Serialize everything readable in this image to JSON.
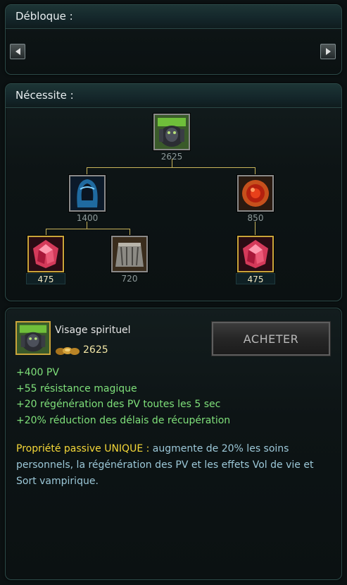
{
  "unlock": {
    "title": "Débloque :"
  },
  "requires": {
    "title": "Nécessite :",
    "tree": {
      "root": {
        "name": "Visage spirituel",
        "icon": "armor-helm-icon",
        "price": "2625"
      },
      "children": [
        {
          "icon": "hooded-cloak-icon",
          "price": "1400",
          "children": [
            {
              "icon": "ruby-crystal-icon",
              "price": "475",
              "owned": true
            },
            {
              "icon": "cloth-cloak-icon",
              "price": "720",
              "owned": false
            }
          ]
        },
        {
          "icon": "red-orb-icon",
          "price": "850",
          "children": [
            {
              "icon": "ruby-crystal-icon",
              "price": "475",
              "owned": true
            }
          ]
        }
      ]
    }
  },
  "info": {
    "name": "Visage spirituel",
    "icon": "armor-helm-icon",
    "cost": "2625",
    "buy_label": "ACHETER",
    "stats": [
      "+400 PV",
      "+55 résistance magique",
      "+20 régénération des PV toutes les 5 sec",
      "+20% réduction des délais de récupération"
    ],
    "passive_label": "Propriété passive UNIQUE :",
    "passive_text": " augmente de 20% les soins personnels, la régénération des PV et les effets Vol de vie et Sort vampirique."
  },
  "colors": {
    "accent_gold": "#c9a53a",
    "stat_green": "#7fe07a",
    "passive_blue": "#9cc8d8",
    "unique_yellow": "#f5d838"
  }
}
